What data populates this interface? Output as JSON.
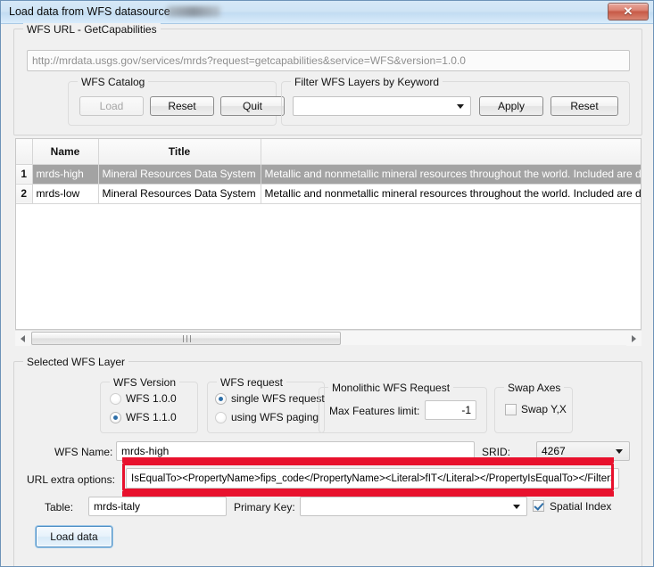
{
  "window": {
    "title": "Load data from WFS datasource",
    "close_label": "✕"
  },
  "wfs_url_group": {
    "legend": "WFS URL - GetCapabilities",
    "url_value": "http://mrdata.usgs.gov/services/mrds?request=getcapabilities&service=WFS&version=1.0.0"
  },
  "wfs_catalog": {
    "legend": "WFS Catalog",
    "load_label": "Load",
    "reset_label": "Reset",
    "quit_label": "Quit"
  },
  "filter_group": {
    "legend": "Filter WFS Layers by Keyword",
    "keyword_value": "",
    "apply_label": "Apply",
    "reset_label": "Reset"
  },
  "layers_table": {
    "headers": [
      "",
      "Name",
      "Title",
      ""
    ],
    "rows": [
      {
        "index": "1",
        "name": "mrds-high",
        "title": "Mineral Resources Data System",
        "abstract": "Metallic and nonmetallic mineral resources throughout the world. Included are deposit name,",
        "selected": true
      },
      {
        "index": "2",
        "name": "mrds-low",
        "title": "Mineral Resources Data System",
        "abstract": "Metallic and nonmetallic mineral resources throughout the world. Included are deposit name,",
        "selected": false
      }
    ]
  },
  "selected_layer": {
    "legend": "Selected WFS Layer",
    "version_group": {
      "legend": "WFS Version",
      "option_100": "WFS 1.0.0",
      "option_110": "WFS 1.1.0",
      "selected": "WFS 1.1.0"
    },
    "request_group": {
      "legend": "WFS request",
      "option_single": "single WFS request",
      "option_paging": "using WFS paging",
      "selected": "single WFS request"
    },
    "monolithic_group": {
      "legend": "Monolithic WFS Request",
      "max_features_label": "Max Features limit:",
      "max_features_value": "-1"
    },
    "swap_group": {
      "legend": "Swap Axes",
      "swap_label": "Swap Y,X",
      "swap_checked": false
    },
    "wfs_name_label": "WFS Name:",
    "wfs_name_value": "mrds-high",
    "srid_label": "SRID:",
    "srid_value": "4267",
    "url_extra_label": "URL extra options:",
    "url_extra_value": "IsEqualTo><PropertyName>fips_code</PropertyName><Literal>fIT</Literal></PropertyIsEqualTo></Filter>",
    "table_label": "Table:",
    "table_value": "mrds-italy",
    "primary_key_label": "Primary Key:",
    "primary_key_value": "",
    "spatial_index_label": "Spatial Index",
    "spatial_index_checked": true
  },
  "load_data_button": {
    "label": "Load data"
  },
  "colors": {
    "highlight_red": "#e8112d",
    "titlebar": "#cfe4f5",
    "selection_grey": "#a3a3a3",
    "accent_blue": "#2f6fa8"
  }
}
